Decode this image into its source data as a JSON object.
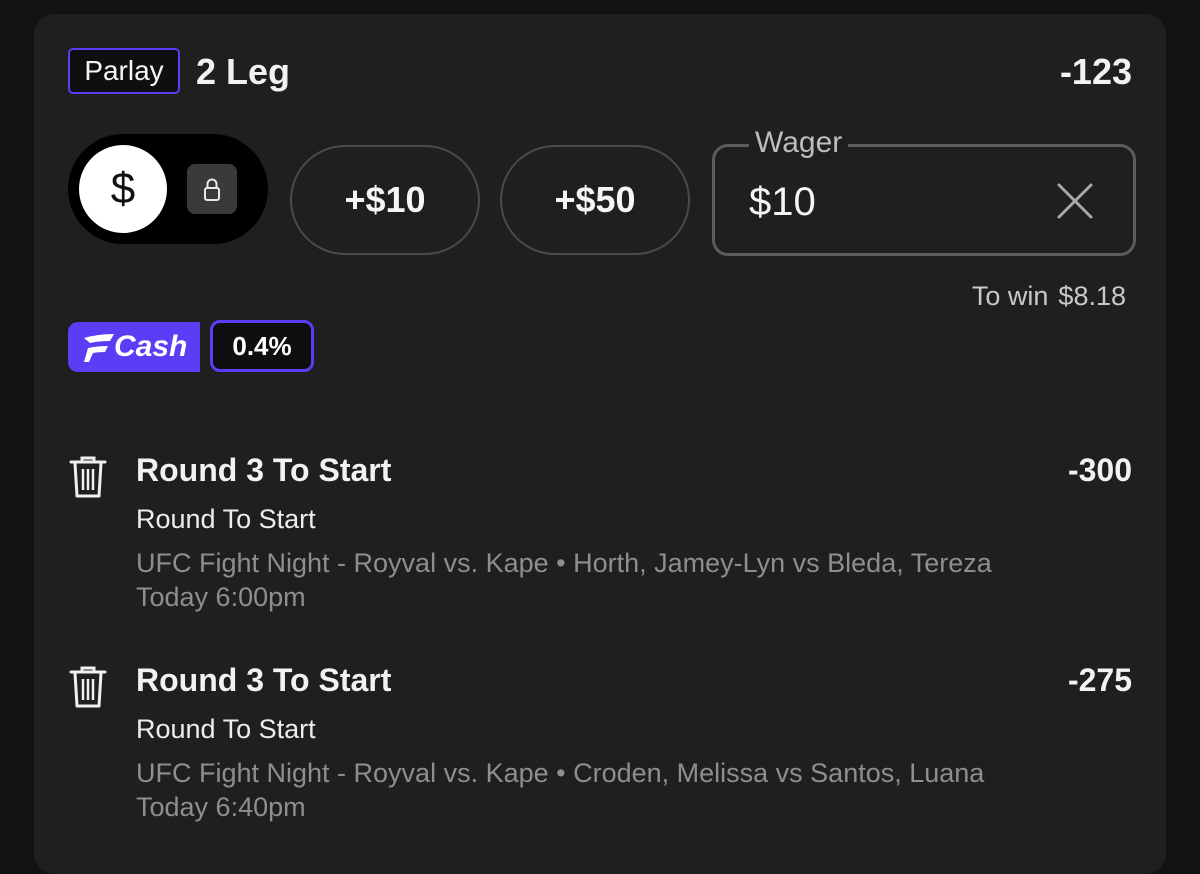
{
  "header": {
    "badge": "Parlay",
    "legs": "2 Leg",
    "odds": "-123"
  },
  "stake": {
    "toggle_symbol": "$",
    "quick_buttons": [
      "+$10",
      "+$50"
    ],
    "wager_label": "Wager",
    "wager_value": "$10",
    "to_win_label": "To win",
    "to_win_amount": "$8.18"
  },
  "fcash": {
    "label": "Cash",
    "percent": "0.4%",
    "color": "#5b3df5"
  },
  "legs": [
    {
      "title": "Round 3 To Start",
      "odds": "-300",
      "market": "Round To Start",
      "event": "UFC Fight Night - Royval vs. Kape • Horth, Jamey-Lyn vs Bleda, Tereza",
      "time": "Today 6:00pm"
    },
    {
      "title": "Round 3 To Start",
      "odds": "-275",
      "market": "Round To Start",
      "event": "UFC Fight Night - Royval vs. Kape • Croden, Melissa vs Santos, Luana",
      "time": "Today 6:40pm"
    }
  ],
  "icons": {
    "trash": "trash-icon",
    "lock": "lock-icon",
    "clear": "close-icon"
  }
}
